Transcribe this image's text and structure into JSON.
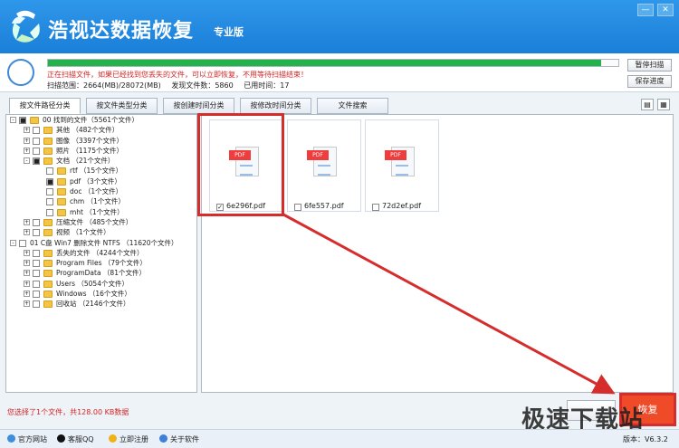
{
  "app": {
    "title": "浩视达数据恢复",
    "edition": "专业版",
    "minimize": "—",
    "close": "✕"
  },
  "scan": {
    "progress_percent": 97,
    "message": "正在扫描文件，如果已经找到您丢失的文件，可以立即恢复，不用等待扫描结束！",
    "range": "扫描范围：2664(MB)/28072(MB)",
    "found": "发现文件数：5860",
    "elapsed": "已用时间：17",
    "pause": "暂停扫描",
    "save": "保存进度"
  },
  "tabs": [
    "按文件路径分类",
    "按文件类型分类",
    "按创建时间分类",
    "按修改时间分类",
    "文件搜索"
  ],
  "tree": [
    {
      "label": "00 找到的文件（5561个文件）",
      "level": 0,
      "exp": "-",
      "checked": "partial",
      "folder": true
    },
    {
      "label": "其他 （482个文件）",
      "level": 1,
      "exp": "+",
      "checked": "no",
      "folder": true
    },
    {
      "label": "图像 （3397个文件）",
      "level": 1,
      "exp": "+",
      "checked": "no",
      "folder": true
    },
    {
      "label": "照片 （1175个文件）",
      "level": 1,
      "exp": "+",
      "checked": "no",
      "folder": true
    },
    {
      "label": "文档 （21个文件）",
      "level": 1,
      "exp": "-",
      "checked": "partial",
      "folder": true
    },
    {
      "label": "rtf （15个文件）",
      "level": 2,
      "exp": "",
      "checked": "no",
      "folder": true
    },
    {
      "label": "pdf （3个文件）",
      "level": 2,
      "exp": "",
      "checked": "partial",
      "folder": true
    },
    {
      "label": "doc （1个文件）",
      "level": 2,
      "exp": "",
      "checked": "no",
      "folder": true
    },
    {
      "label": "chm （1个文件）",
      "level": 2,
      "exp": "",
      "checked": "no",
      "folder": true
    },
    {
      "label": "mht （1个文件）",
      "level": 2,
      "exp": "",
      "checked": "no",
      "folder": true
    },
    {
      "label": "压缩文件 （485个文件）",
      "level": 1,
      "exp": "+",
      "checked": "no",
      "folder": true
    },
    {
      "label": "视频 （1个文件）",
      "level": 1,
      "exp": "+",
      "checked": "no",
      "folder": true
    },
    {
      "label": "01 C盘 Win7 删除文件 NTFS （11620个文件）",
      "level": 0,
      "exp": "-",
      "checked": "no",
      "folder": false
    },
    {
      "label": "丢失的文件 （4244个文件）",
      "level": 1,
      "exp": "+",
      "checked": "no",
      "folder": true
    },
    {
      "label": "Program Files （79个文件）",
      "level": 1,
      "exp": "+",
      "checked": "no",
      "folder": true
    },
    {
      "label": "ProgramData （81个文件）",
      "level": 1,
      "exp": "+",
      "checked": "no",
      "folder": true
    },
    {
      "label": "Users （5054个文件）",
      "level": 1,
      "exp": "+",
      "checked": "no",
      "folder": true
    },
    {
      "label": "Windows （16个文件）",
      "level": 1,
      "exp": "+",
      "checked": "no",
      "folder": true
    },
    {
      "label": "回收站 （2146个文件）",
      "level": 1,
      "exp": "+",
      "checked": "no",
      "folder": true
    }
  ],
  "files": [
    {
      "name": "6e296f.pdf",
      "type": "PDF",
      "checked": true
    },
    {
      "name": "6fe557.pdf",
      "type": "PDF",
      "checked": false
    },
    {
      "name": "72d2ef.pdf",
      "type": "PDF",
      "checked": false
    }
  ],
  "selection": "您选择了1个文件，共128.00 KB数据",
  "footer": {
    "website": "官方网站",
    "qq": "客服QQ",
    "register": "立即注册",
    "about": "关于软件",
    "version": "版本：V6.3.2"
  },
  "watermark": "极速下载站",
  "actions": {
    "cancel": "",
    "recover": "恢复"
  },
  "view_icons": [
    "▤",
    "▦"
  ]
}
